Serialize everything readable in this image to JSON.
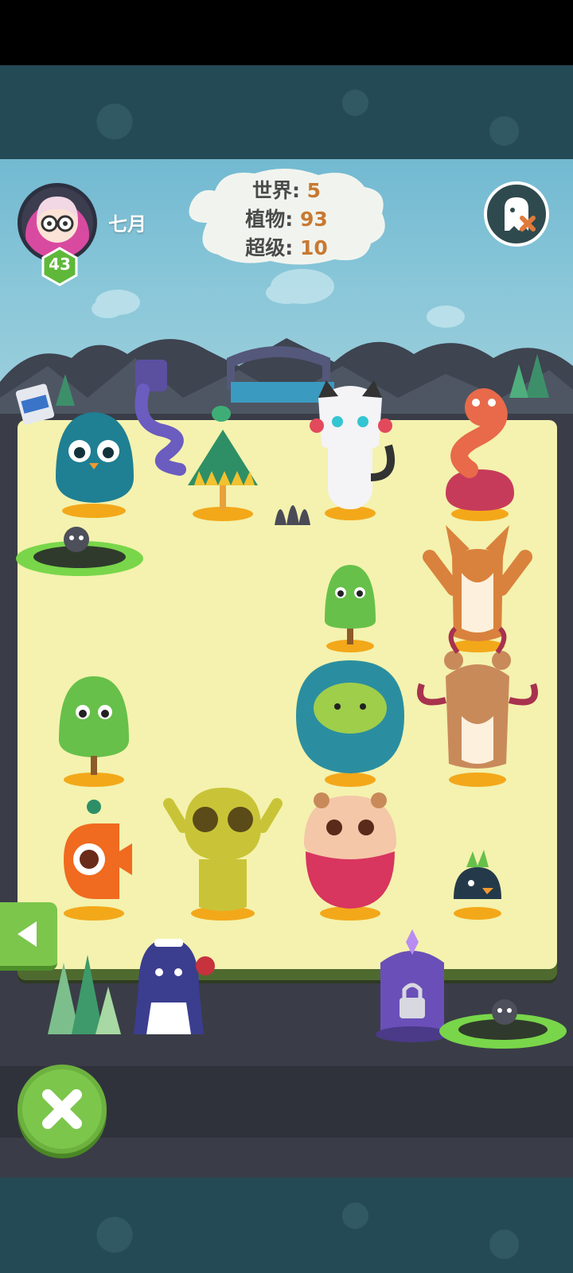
{
  "player": {
    "name": "七月",
    "level": "43"
  },
  "stats": {
    "world_label": "世界:",
    "world_value": "5",
    "plants_label": "植物:",
    "plants_value": "93",
    "super_label": "超级:",
    "super_value": "10"
  },
  "icons": {
    "top_right": "ghost-mute-icon",
    "left_side": "triangle-left-icon",
    "bottom_left": "close-x-icon",
    "locked_pedestal": "padlock-icon"
  },
  "colors": {
    "playfield": "#f4f2ae",
    "accent_green": "#7cc64c",
    "stat_value": "#c87932",
    "dark_ground": "#3a3d47",
    "teal_strip": "#244a55"
  }
}
